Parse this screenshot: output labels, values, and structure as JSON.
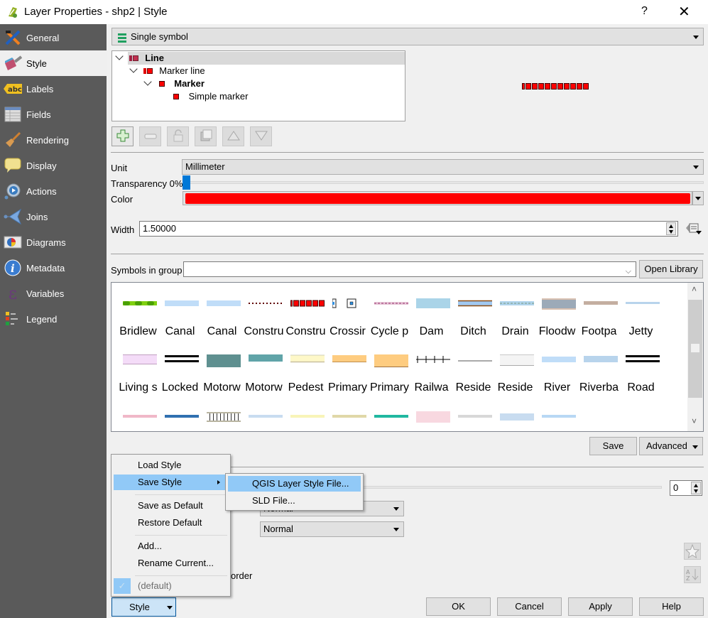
{
  "window": {
    "title": "Layer Properties - shp2 | Style",
    "help_label": "?",
    "close_label": "✕"
  },
  "sidebar": {
    "items": [
      {
        "label": "General",
        "icon": "tools-icon"
      },
      {
        "label": "Style",
        "icon": "paintbrush-icon",
        "active": true
      },
      {
        "label": "Labels",
        "icon": "abc-label-icon"
      },
      {
        "label": "Fields",
        "icon": "table-icon"
      },
      {
        "label": "Rendering",
        "icon": "brush-icon"
      },
      {
        "label": "Display",
        "icon": "speech-bubble-icon"
      },
      {
        "label": "Actions",
        "icon": "gear-play-icon"
      },
      {
        "label": "Joins",
        "icon": "join-arrow-icon"
      },
      {
        "label": "Diagrams",
        "icon": "pie-chart-icon"
      },
      {
        "label": "Metadata",
        "icon": "info-icon"
      },
      {
        "label": "Variables",
        "icon": "epsilon-icon"
      },
      {
        "label": "Legend",
        "icon": "legend-icon"
      }
    ]
  },
  "renderer": {
    "selected": "Single symbol"
  },
  "symbol_tree": {
    "items": [
      {
        "label": "Line",
        "bold": true
      },
      {
        "label": "Marker line",
        "bold": false
      },
      {
        "label": "Marker",
        "bold": true
      },
      {
        "label": "Simple marker",
        "bold": false
      }
    ]
  },
  "layer_tools": {
    "add": "add-layer",
    "remove": "remove-layer",
    "lock": "lock-color",
    "duplicate": "duplicate-layer",
    "up": "move-up",
    "down": "move-down"
  },
  "properties": {
    "unit_label": "Unit",
    "unit_value": "Millimeter",
    "transparency_label": "Transparency 0%",
    "transparency_value": 0,
    "color_label": "Color",
    "color_value": "#ff0000",
    "width_label": "Width",
    "width_value": "1.50000"
  },
  "library": {
    "group_label": "Symbols in group",
    "group_value": "",
    "open_library_label": "Open Library",
    "symbols": [
      {
        "name": "Bridlew",
        "style": "dashed-green"
      },
      {
        "name": "Canal",
        "style": "light-blue"
      },
      {
        "name": "Canal",
        "style": "light-blue"
      },
      {
        "name": "Constru",
        "style": "dotted-dark-red"
      },
      {
        "name": "Constru",
        "style": "red-squares"
      },
      {
        "name": "Crossir",
        "style": "square-marker"
      },
      {
        "name": "Cycle p",
        "style": "dashed-pink"
      },
      {
        "name": "Dam",
        "style": "blue-thick"
      },
      {
        "name": "Ditch",
        "style": "brown-blue"
      },
      {
        "name": "Drain",
        "style": "blue-dashed"
      },
      {
        "name": "Floodw",
        "style": "gray-brown"
      },
      {
        "name": "Footpa",
        "style": "tan"
      },
      {
        "name": "Jetty",
        "style": "thin-blue"
      },
      {
        "name": "Living s",
        "style": "lilac"
      },
      {
        "name": "Locked",
        "style": "double-black"
      },
      {
        "name": "Motorw",
        "style": "teal-thick"
      },
      {
        "name": "Motorw",
        "style": "teal"
      },
      {
        "name": "Pedest",
        "style": "cream"
      },
      {
        "name": "Primary",
        "style": "orange"
      },
      {
        "name": "Primary",
        "style": "orange-thick"
      },
      {
        "name": "Railwa",
        "style": "rail"
      },
      {
        "name": "Reside",
        "style": "thin-gray"
      },
      {
        "name": "Reside",
        "style": "white-gray"
      },
      {
        "name": "River",
        "style": "light-blue"
      },
      {
        "name": "Riverba",
        "style": "steel-blue"
      },
      {
        "name": "Road",
        "style": "double-black"
      }
    ],
    "save_label": "Save",
    "advanced_label": "Advanced"
  },
  "layer_rendering": {
    "blend_layer": "Normal",
    "blend_feature": "Normal",
    "order_label": "order",
    "spin_value": "0"
  },
  "style_menu": {
    "items": [
      {
        "label": "Load Style"
      },
      {
        "label": "Save Style",
        "highlighted": true,
        "submenu": true
      },
      {
        "label": "Save as Default"
      },
      {
        "label": "Restore Default"
      },
      {
        "label": "Add..."
      },
      {
        "label": "Rename Current..."
      },
      {
        "label": "(default)",
        "checked": true,
        "disabled": true
      }
    ],
    "submenu": [
      {
        "label": "QGIS Layer Style File...",
        "highlighted": true
      },
      {
        "label": "SLD File..."
      }
    ]
  },
  "footer": {
    "style_button": "Style",
    "ok": "OK",
    "cancel": "Cancel",
    "apply": "Apply",
    "help": "Help"
  }
}
